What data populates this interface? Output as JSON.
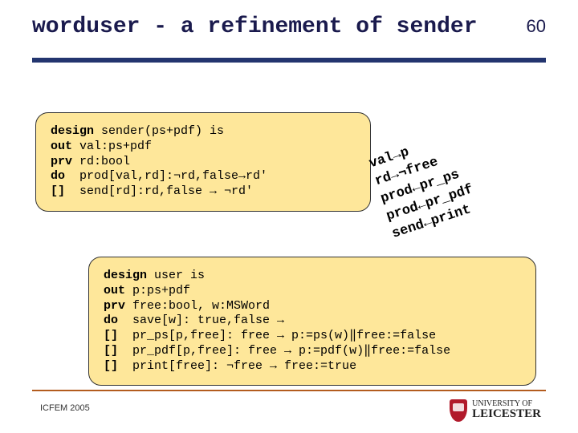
{
  "header": {
    "title_prefix": "worduser",
    "title_rest": " - a refinement of sender",
    "page_number": "60"
  },
  "sender_box": {
    "l1_kw": "design",
    "l1_rest": " sender(ps+pdf) is",
    "l2_kw": "out",
    "l2_rest": " val:ps+pdf",
    "l3_kw": "prv",
    "l3_rest": " rd:bool",
    "l4_kw": "do",
    "l4_rest": "  prod[val,rd]:¬rd,false→rd'",
    "l5_kw": "[]",
    "l5_rest": "  send[rd]:rd,false → ¬rd'"
  },
  "annotation": {
    "l1": "val→p",
    "l2": "rd→¬free",
    "l3": "prod←pr_ps",
    "l4": "prod←pr_pdf",
    "l5": "send←print"
  },
  "user_box": {
    "l1_kw": "design",
    "l1_rest": " user is",
    "l2_kw": "out",
    "l2_rest": " p:ps+pdf",
    "l3_kw": "prv",
    "l3_rest": " free:bool, w:MSWord",
    "l4_kw": "do",
    "l4_rest": "  save[w]: true,false →",
    "l5_kw": "[]",
    "l5_rest": "  pr_ps[p,free]: free → p:=ps(w)‖free:=false",
    "l6_kw": "[]",
    "l6_rest": "  pr_pdf[p,free]: free → p:=pdf(w)‖free:=false",
    "l7_kw": "[]",
    "l7_rest": "  print[free]: ¬free → free:=true"
  },
  "footer": {
    "conference": "ICFEM 2005",
    "uni_small": "UNIVERSITY OF",
    "uni_big": "LEICESTER"
  }
}
